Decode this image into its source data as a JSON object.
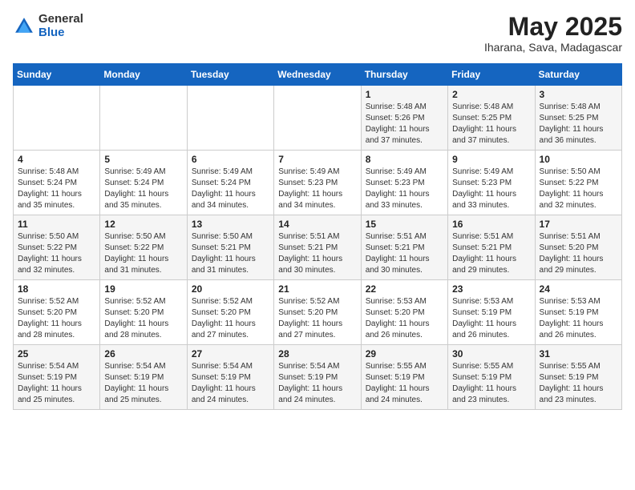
{
  "logo": {
    "general": "General",
    "blue": "Blue"
  },
  "title": {
    "month_year": "May 2025",
    "location": "Iharana, Sava, Madagascar"
  },
  "days_of_week": [
    "Sunday",
    "Monday",
    "Tuesday",
    "Wednesday",
    "Thursday",
    "Friday",
    "Saturday"
  ],
  "weeks": [
    [
      {
        "day": "",
        "info": ""
      },
      {
        "day": "",
        "info": ""
      },
      {
        "day": "",
        "info": ""
      },
      {
        "day": "",
        "info": ""
      },
      {
        "day": "1",
        "info": "Sunrise: 5:48 AM\nSunset: 5:26 PM\nDaylight: 11 hours\nand 37 minutes."
      },
      {
        "day": "2",
        "info": "Sunrise: 5:48 AM\nSunset: 5:25 PM\nDaylight: 11 hours\nand 37 minutes."
      },
      {
        "day": "3",
        "info": "Sunrise: 5:48 AM\nSunset: 5:25 PM\nDaylight: 11 hours\nand 36 minutes."
      }
    ],
    [
      {
        "day": "4",
        "info": "Sunrise: 5:48 AM\nSunset: 5:24 PM\nDaylight: 11 hours\nand 35 minutes."
      },
      {
        "day": "5",
        "info": "Sunrise: 5:49 AM\nSunset: 5:24 PM\nDaylight: 11 hours\nand 35 minutes."
      },
      {
        "day": "6",
        "info": "Sunrise: 5:49 AM\nSunset: 5:24 PM\nDaylight: 11 hours\nand 34 minutes."
      },
      {
        "day": "7",
        "info": "Sunrise: 5:49 AM\nSunset: 5:23 PM\nDaylight: 11 hours\nand 34 minutes."
      },
      {
        "day": "8",
        "info": "Sunrise: 5:49 AM\nSunset: 5:23 PM\nDaylight: 11 hours\nand 33 minutes."
      },
      {
        "day": "9",
        "info": "Sunrise: 5:49 AM\nSunset: 5:23 PM\nDaylight: 11 hours\nand 33 minutes."
      },
      {
        "day": "10",
        "info": "Sunrise: 5:50 AM\nSunset: 5:22 PM\nDaylight: 11 hours\nand 32 minutes."
      }
    ],
    [
      {
        "day": "11",
        "info": "Sunrise: 5:50 AM\nSunset: 5:22 PM\nDaylight: 11 hours\nand 32 minutes."
      },
      {
        "day": "12",
        "info": "Sunrise: 5:50 AM\nSunset: 5:22 PM\nDaylight: 11 hours\nand 31 minutes."
      },
      {
        "day": "13",
        "info": "Sunrise: 5:50 AM\nSunset: 5:21 PM\nDaylight: 11 hours\nand 31 minutes."
      },
      {
        "day": "14",
        "info": "Sunrise: 5:51 AM\nSunset: 5:21 PM\nDaylight: 11 hours\nand 30 minutes."
      },
      {
        "day": "15",
        "info": "Sunrise: 5:51 AM\nSunset: 5:21 PM\nDaylight: 11 hours\nand 30 minutes."
      },
      {
        "day": "16",
        "info": "Sunrise: 5:51 AM\nSunset: 5:21 PM\nDaylight: 11 hours\nand 29 minutes."
      },
      {
        "day": "17",
        "info": "Sunrise: 5:51 AM\nSunset: 5:20 PM\nDaylight: 11 hours\nand 29 minutes."
      }
    ],
    [
      {
        "day": "18",
        "info": "Sunrise: 5:52 AM\nSunset: 5:20 PM\nDaylight: 11 hours\nand 28 minutes."
      },
      {
        "day": "19",
        "info": "Sunrise: 5:52 AM\nSunset: 5:20 PM\nDaylight: 11 hours\nand 28 minutes."
      },
      {
        "day": "20",
        "info": "Sunrise: 5:52 AM\nSunset: 5:20 PM\nDaylight: 11 hours\nand 27 minutes."
      },
      {
        "day": "21",
        "info": "Sunrise: 5:52 AM\nSunset: 5:20 PM\nDaylight: 11 hours\nand 27 minutes."
      },
      {
        "day": "22",
        "info": "Sunrise: 5:53 AM\nSunset: 5:20 PM\nDaylight: 11 hours\nand 26 minutes."
      },
      {
        "day": "23",
        "info": "Sunrise: 5:53 AM\nSunset: 5:19 PM\nDaylight: 11 hours\nand 26 minutes."
      },
      {
        "day": "24",
        "info": "Sunrise: 5:53 AM\nSunset: 5:19 PM\nDaylight: 11 hours\nand 26 minutes."
      }
    ],
    [
      {
        "day": "25",
        "info": "Sunrise: 5:54 AM\nSunset: 5:19 PM\nDaylight: 11 hours\nand 25 minutes."
      },
      {
        "day": "26",
        "info": "Sunrise: 5:54 AM\nSunset: 5:19 PM\nDaylight: 11 hours\nand 25 minutes."
      },
      {
        "day": "27",
        "info": "Sunrise: 5:54 AM\nSunset: 5:19 PM\nDaylight: 11 hours\nand 24 minutes."
      },
      {
        "day": "28",
        "info": "Sunrise: 5:54 AM\nSunset: 5:19 PM\nDaylight: 11 hours\nand 24 minutes."
      },
      {
        "day": "29",
        "info": "Sunrise: 5:55 AM\nSunset: 5:19 PM\nDaylight: 11 hours\nand 24 minutes."
      },
      {
        "day": "30",
        "info": "Sunrise: 5:55 AM\nSunset: 5:19 PM\nDaylight: 11 hours\nand 23 minutes."
      },
      {
        "day": "31",
        "info": "Sunrise: 5:55 AM\nSunset: 5:19 PM\nDaylight: 11 hours\nand 23 minutes."
      }
    ]
  ]
}
